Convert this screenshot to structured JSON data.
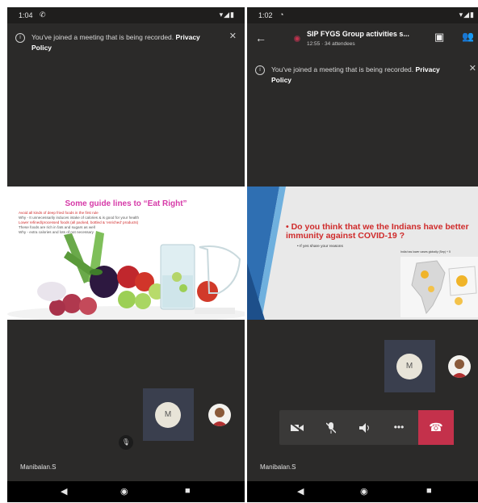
{
  "left_screen": {
    "status": {
      "time": "1:04",
      "call_icon": "phone-icon",
      "right_icons": "signal-wifi-battery-icons"
    },
    "banner": {
      "text": "You've joined a meeting that is being recorded.",
      "link": "Privacy Policy"
    },
    "slide": {
      "title": "Some guide lines to “Eat Right”",
      "bullets": [
        "Avoid all kinds of deep fried foods in the first rule",
        "Why - It unnecessarily induces intake of calories & is good for your health",
        "Lower refined/processed foods (all packed, bottled & ‘enriched’ products)",
        "These foods are rich in fats and sugars as well",
        "Why - extra calories and lots of not necessary"
      ]
    },
    "participant": {
      "initial": "M",
      "name": "Manibalan.S"
    }
  },
  "right_screen": {
    "status": {
      "time": "1:02",
      "app_icon": "whatsapp-icon",
      "right_icons": "signal-wifi-battery-icons"
    },
    "header": {
      "title": "SIP FYGS Group activities s...",
      "subtitle": "12:55 · 34 attendees"
    },
    "banner": {
      "text": "You've joined a meeting that is being recorded.",
      "link": "Privacy Policy"
    },
    "slide": {
      "title": "Do you think that we the Indians have better immunity against COVID-19 ?",
      "subtitle": "If yes share your reasons",
      "map_heading": "India has lower cases globally (Sep) + 5"
    },
    "participant": {
      "initial": "M",
      "name": "Manibalan.S"
    },
    "controls": [
      "video-off-icon",
      "mic-off-icon",
      "speaker-icon",
      "more-icon",
      "hangup-icon"
    ]
  },
  "colors": {
    "background": "#2b2a29",
    "hangup": "#c4314b",
    "slide1_title": "#d63aa8",
    "slide2_title": "#cf2b2b"
  }
}
